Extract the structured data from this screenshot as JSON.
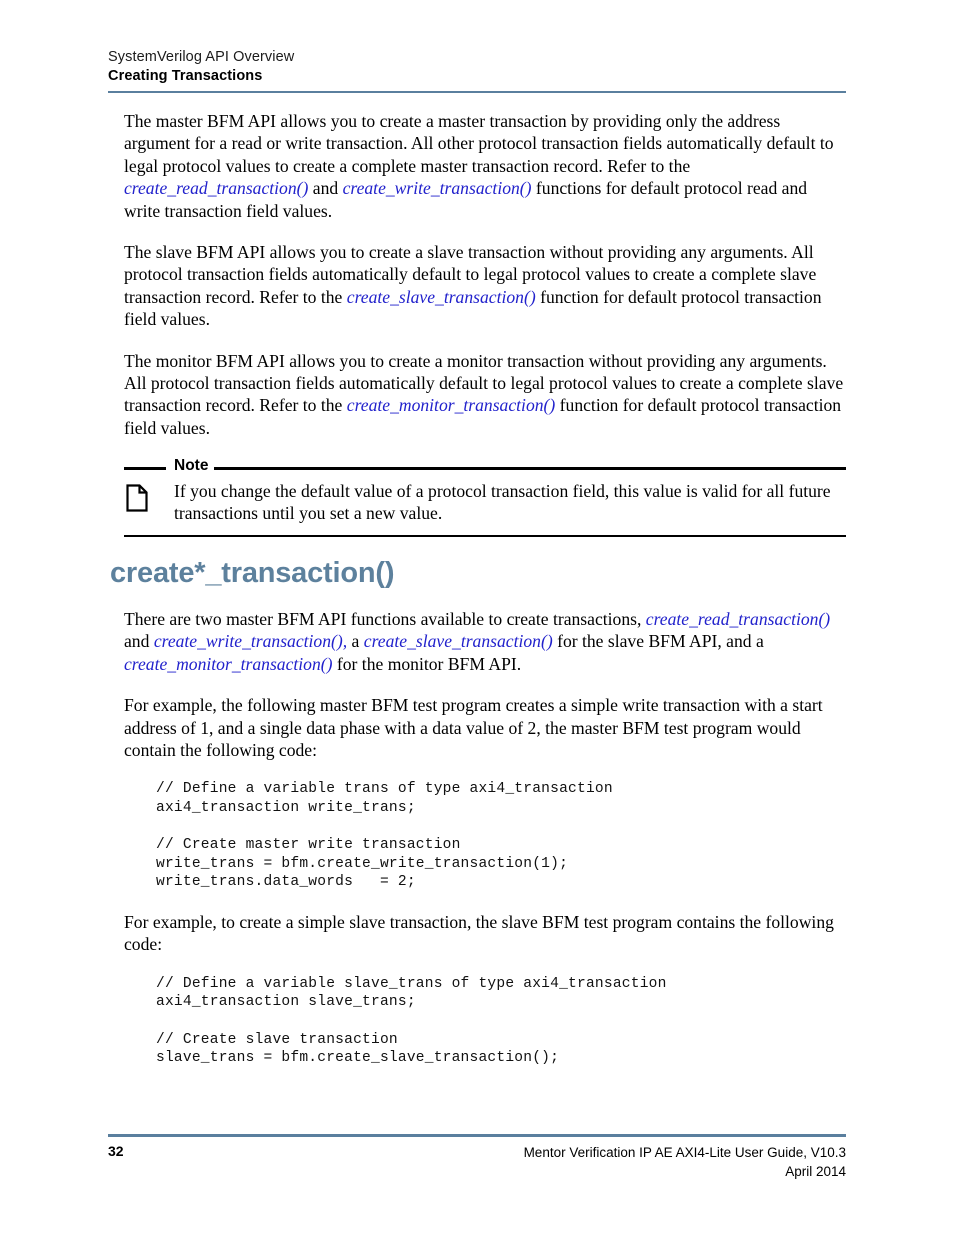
{
  "header": {
    "chapter": "SystemVerilog API Overview",
    "section": "Creating Transactions"
  },
  "paragraphs": {
    "master_1": "The master BFM API allows you to create a master transaction by providing only the address argument for a read or write transaction. All other protocol transaction fields automatically default to legal protocol values to create a complete master transaction record. Refer to the ",
    "master_link_1": "create_read_transaction()",
    "master_2": " and ",
    "master_link_2": "create_write_transaction()",
    "master_3": " functions for default protocol read and write transaction field values.",
    "slave_1": "The slave BFM API allows you to create a slave transaction without providing any arguments. All protocol transaction fields automatically default to legal protocol values to create a complete slave transaction record. Refer to the ",
    "slave_link_1": "create_slave_transaction()",
    "slave_2": " function for default protocol transaction field values.",
    "monitor_1": "The monitor BFM API allows you to create a monitor transaction without providing any arguments. All protocol transaction fields automatically default to legal protocol values to create a complete slave transaction record. Refer to the ",
    "monitor_link_1": "create_monitor_transaction()",
    "monitor_2": " function for default protocol transaction field values.",
    "intro_1": "There are two master BFM API functions available to create transactions, ",
    "intro_link_1": "create_read_transaction()",
    "intro_2": " and ",
    "intro_link_2": "create_write_transaction(),",
    "intro_3": " a ",
    "intro_link_3": "create_slave_transaction()",
    "intro_4": " for the slave BFM API, and a ",
    "intro_link_4": "create_monitor_transaction()",
    "intro_5": " for the monitor BFM API.",
    "example_master": "For example, the following master BFM test program creates a simple write transaction with a start address of 1, and a single data phase with a data value of 2, the master BFM test program would contain the following code:",
    "example_slave": "For example, to create a simple slave transaction, the slave BFM test program contains the following code:"
  },
  "note": {
    "title": "Note",
    "icon": "page-icon",
    "text": "If you change the default value of a protocol transaction field, this value is valid for all future transactions until you set a new value."
  },
  "section_heading": "create*_transaction()",
  "code_blocks": {
    "master": "// Define a variable trans of type axi4_transaction\naxi4_transaction write_trans;\n\n// Create master write transaction\nwrite_trans = bfm.create_write_transaction(1);\nwrite_trans.data_words   = 2;",
    "slave": "// Define a variable slave_trans of type axi4_transaction\naxi4_transaction slave_trans;\n\n// Create slave transaction\nslave_trans = bfm.create_slave_transaction();"
  },
  "footer": {
    "page_number": "32",
    "document_title": "Mentor Verification IP AE AXI4-Lite User Guide, V10.3",
    "date": "April 2014"
  },
  "colors": {
    "rule": "#5a7f9e",
    "heading": "#5d819d",
    "link": "#2222cc"
  }
}
